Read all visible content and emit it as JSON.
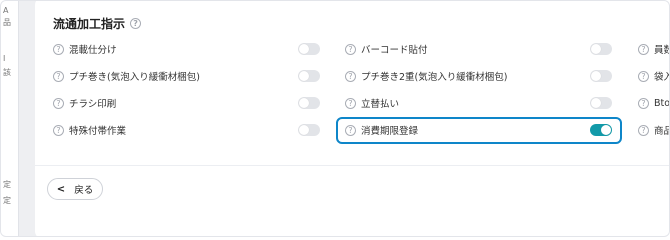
{
  "sidebar": {
    "glyphs": [
      "A",
      "品",
      "I",
      "該",
      "定",
      "定"
    ]
  },
  "section": {
    "title": "流通加工指示"
  },
  "options": {
    "col1": [
      {
        "label": "混載仕分け",
        "on": false
      },
      {
        "label": "プチ巻き(気泡入り緩衝材梱包)",
        "on": false
      },
      {
        "label": "チラシ印刷",
        "on": false
      },
      {
        "label": "特殊付帯作業",
        "on": false
      }
    ],
    "col2": [
      {
        "label": "バーコード貼付",
        "on": false
      },
      {
        "label": "プチ巻き2重(気泡入り緩衝材梱包)",
        "on": false
      },
      {
        "label": "立替払い",
        "on": false
      },
      {
        "label": "消費期限登録",
        "on": true
      }
    ],
    "col3": [
      {
        "label": "員数"
      },
      {
        "label": "袋入"
      },
      {
        "label": "BtoB"
      },
      {
        "label": "商品"
      }
    ]
  },
  "footer": {
    "back_label": "戻る"
  },
  "colors": {
    "toggle_on": "#129aa9",
    "highlight": "#0e86c9"
  }
}
